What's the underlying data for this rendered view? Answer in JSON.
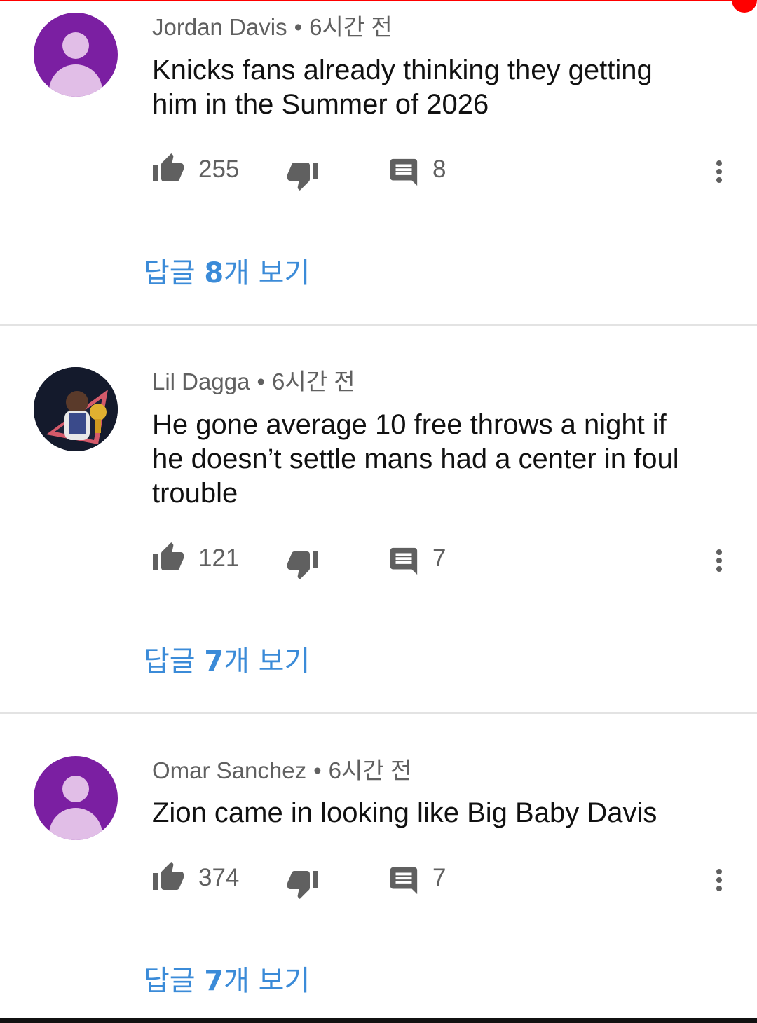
{
  "colors": {
    "accent_red": "#ff0000",
    "link_blue": "#3b8bd8",
    "avatar_purple": "#7b1fa2",
    "avatar_light": "#e1bee7",
    "meta_gray": "#606060",
    "icon_gray": "#606060"
  },
  "icons": {
    "like": "thumb-up-icon",
    "dislike": "thumb-down-icon",
    "reply": "comment-icon",
    "more": "more-vertical-icon"
  },
  "comments": [
    {
      "author": "Jordan Davis",
      "separator": "•",
      "time": "6시간 전",
      "text_lines": [
        "Knicks fans already thinking they getting",
        "him in the Summer of 2026"
      ],
      "likes": "255",
      "replies_count": "8",
      "view_replies": {
        "prefix": "답글 ",
        "number": "8",
        "suffix": "개 보기"
      }
    },
    {
      "author": "Lil Dagga",
      "separator": "•",
      "time": "6시간 전",
      "text_lines": [
        "He gone average 10 free throws a night if",
        "he doesn’t settle mans had a center in foul",
        "trouble"
      ],
      "likes": "121",
      "replies_count": "7",
      "view_replies": {
        "prefix": "답글 ",
        "number": "7",
        "suffix": "개 보기"
      }
    },
    {
      "author": "Omar Sanchez",
      "separator": "•",
      "time": "6시간 전",
      "text_lines": [
        "Zion came in looking like Big Baby Davis"
      ],
      "likes": "374",
      "replies_count": "7",
      "view_replies": {
        "prefix": "답글 ",
        "number": "7",
        "suffix": "개 보기"
      }
    }
  ]
}
